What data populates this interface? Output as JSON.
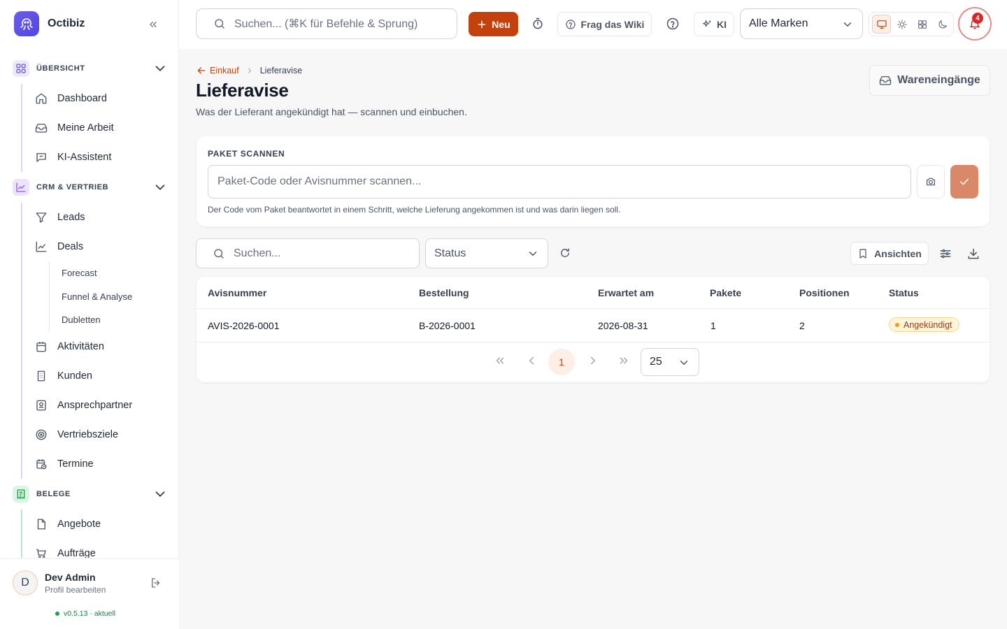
{
  "app": {
    "name": "Octibiz"
  },
  "sidebar": {
    "sections": [
      {
        "label": "ÜBERSICHT",
        "items": [
          {
            "label": "Dashboard"
          },
          {
            "label": "Meine Arbeit"
          },
          {
            "label": "KI-Assistent"
          }
        ]
      },
      {
        "label": "CRM & VERTRIEB",
        "items": [
          {
            "label": "Leads"
          },
          {
            "label": "Deals"
          },
          {
            "label": "Aktivitäten"
          },
          {
            "label": "Kunden"
          },
          {
            "label": "Ansprechpartner"
          },
          {
            "label": "Vertriebsziele"
          },
          {
            "label": "Termine"
          }
        ],
        "subitems": [
          {
            "label": "Forecast"
          },
          {
            "label": "Funnel & Analyse"
          },
          {
            "label": "Dubletten"
          }
        ]
      },
      {
        "label": "BELEGE",
        "items": [
          {
            "label": "Angebote"
          },
          {
            "label": "Aufträge"
          }
        ]
      }
    ],
    "user": {
      "initial": "D",
      "name": "Dev Admin",
      "sub": "Profil bearbeiten"
    },
    "version": "v0.5.13 · aktuell"
  },
  "topbar": {
    "search_placeholder": "Suchen... (⌘K für Befehle & Sprung)",
    "new_label": "Neu",
    "wiki_label": "Frag das Wiki",
    "ki_label": "KI",
    "brand_select": "Alle Marken",
    "notifications": "4"
  },
  "page": {
    "breadcrumb_parent": "Einkauf",
    "breadcrumb_current": "Lieferavise",
    "title": "Lieferavise",
    "subtitle": "Was der Lieferant angekündigt hat — scannen und einbuchen.",
    "secondary_button": "Wareneingänge"
  },
  "scan": {
    "label": "PAKET SCANNEN",
    "placeholder": "Paket-Code oder Avisnummer scannen...",
    "hint": "Der Code vom Paket beantwortet in einem Schritt, welche Lieferung angekommen ist und was darin liegen soll."
  },
  "filters": {
    "search_placeholder": "Suchen...",
    "status_placeholder": "Status",
    "views_label": "Ansichten"
  },
  "table": {
    "columns": [
      "Avisnummer",
      "Bestellung",
      "Erwartet am",
      "Pakete",
      "Positionen",
      "Status"
    ],
    "rows": [
      {
        "avis": "AVIS-2026-0001",
        "order": "B-2026-0001",
        "expected": "2026-08-31",
        "packages": "1",
        "positions": "2",
        "status": "Angekündigt"
      }
    ]
  },
  "pagination": {
    "current": "1",
    "page_size": "25"
  },
  "colors": {
    "accent": "#c2410c",
    "sidebar_line": "#d9d6f7",
    "status_warn": "#f59e0b"
  }
}
